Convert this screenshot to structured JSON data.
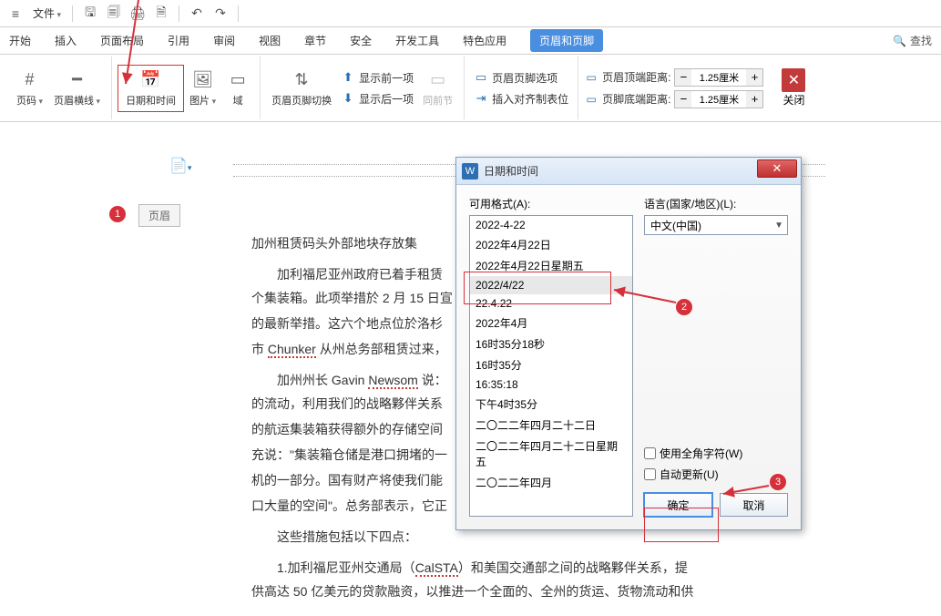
{
  "toolbar": {
    "menu_label": "文件",
    "search_label": "查找"
  },
  "tabs": {
    "items": [
      "开始",
      "插入",
      "页面布局",
      "引用",
      "审阅",
      "视图",
      "章节",
      "安全",
      "开发工具",
      "特色应用"
    ],
    "active": "页眉和页脚"
  },
  "ribbon": {
    "page_number": "页码",
    "page_line": "页眉横线",
    "date_time": "日期和时间",
    "picture": "图片",
    "field": "域",
    "hf_switch": "页眉页脚切换",
    "show_prev": "显示前一项",
    "show_next": "显示后一项",
    "same_prev": "同前节",
    "hf_options": "页眉页脚选项",
    "insert_align": "插入对齐制表位",
    "top_dist_label": "页眉顶端距离:",
    "bot_dist_label": "页脚底端距离:",
    "dist_value": "1.25厘米",
    "close": "关闭"
  },
  "header_tag": "页眉",
  "badges": {
    "b1": "1",
    "b2": "2",
    "b3": "3"
  },
  "content": {
    "title": "加州租赁码头外部地块存放集",
    "p1a": "加利福尼亚州政府已着手租赁",
    "p1b": "个集装箱。此项举措於 2 月 15 日宣",
    "p1c": "的最新举措。这六个地点位於洛杉",
    "p1d_a": "市 ",
    "p1d_wavy": "Chunker",
    "p1d_b": " 从州总务部租赁过来，",
    "p2a_a": "加州州长 Gavin ",
    "p2a_wavy": "Newsom",
    "p2a_b": " 说：",
    "p2b": "的流动，利用我们的战略夥伴关系",
    "p2c": "的航运集装箱获得额外的存储空间",
    "p2d": "充说：\"集装箱仓储是港口拥堵的一",
    "p2e": "机的一部分。国有财产将使我们能",
    "p2f": "口大量的空间\"。总务部表示，它正",
    "p3": "这些措施包括以下四点：",
    "p4_a": "1.加利福尼亚州交通局（",
    "p4_wavy": "CalSTA",
    "p4_b": "）和美国交通部之间的战略夥伴关系，提",
    "p5": "供高达 50 亿美元的贷款融资，以推进一个全面的、全州的货运、货物流动和供"
  },
  "dialog": {
    "title": "日期和时间",
    "formats_label": "可用格式(A):",
    "lang_label": "语言(国家/地区)(L):",
    "lang_value": "中文(中国)",
    "items": [
      {
        "t": "2022-4-22"
      },
      {
        "t": "2022年4月22日"
      },
      {
        "t": "2022年4月22日星期五"
      },
      {
        "t": "2022/4/22",
        "sel": true
      },
      {
        "t": "22.4.22",
        "strike": true
      },
      {
        "t": "2022年4月"
      },
      {
        "t": "16时35分18秒"
      },
      {
        "t": "16时35分"
      },
      {
        "t": "16:35:18"
      },
      {
        "t": "下午4时35分"
      },
      {
        "t": "二〇二二年四月二十二日"
      },
      {
        "t": "二〇二二年四月二十二日星期五"
      },
      {
        "t": "二〇二二年四月"
      }
    ],
    "fullwidth_label": "使用全角字符(W)",
    "autoupdate_label": "自动更新(U)",
    "ok": "确定",
    "cancel": "取消"
  }
}
